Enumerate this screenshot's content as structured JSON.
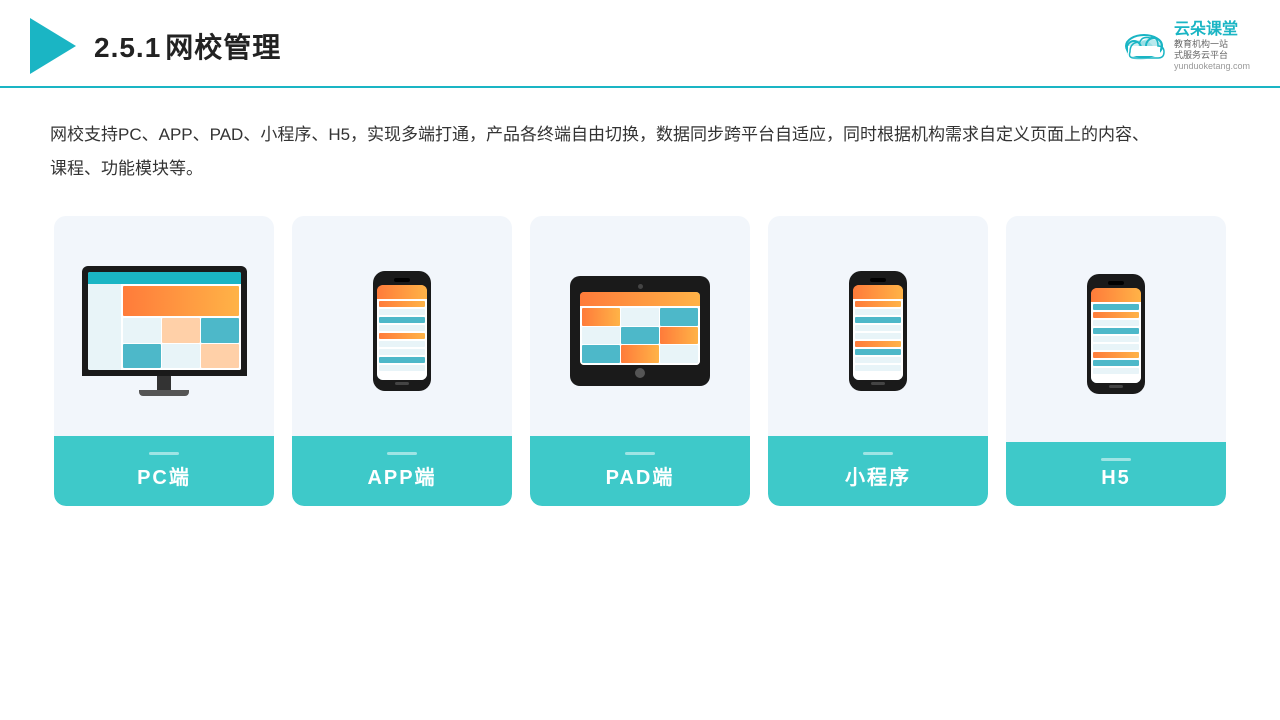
{
  "header": {
    "section": "2.5.1",
    "title": "网校管理",
    "brand_name": "云朵课堂",
    "brand_slogan": "教育机构一站\n式服务云平台",
    "brand_url": "yunduoketang.com"
  },
  "description": "网校支持PC、APP、PAD、小程序、H5，实现多端打通，产品各终端自由切换，数据同步跨平台自适应，同时根据机构需求自定义页面上的内容、课程、功能模块等。",
  "cards": [
    {
      "id": "pc",
      "label": "PC端"
    },
    {
      "id": "app",
      "label": "APP端"
    },
    {
      "id": "pad",
      "label": "PAD端"
    },
    {
      "id": "miniprogram",
      "label": "小程序"
    },
    {
      "id": "h5",
      "label": "H5"
    }
  ],
  "colors": {
    "teal": "#3ec9c9",
    "teal_dark": "#1ab5c4",
    "bg_card": "#f2f6fb"
  }
}
